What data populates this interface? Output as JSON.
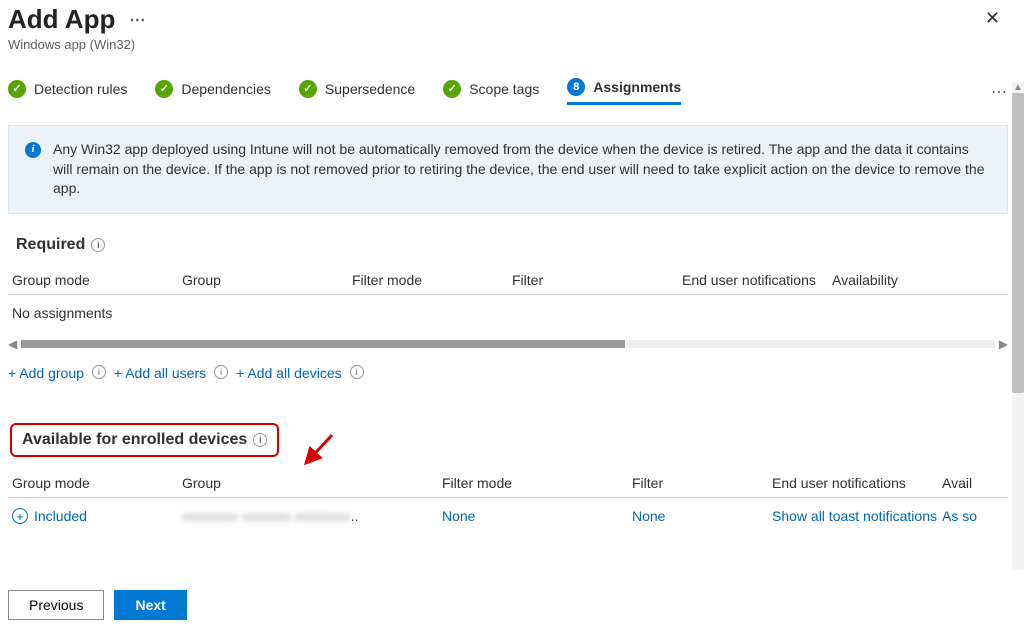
{
  "header": {
    "title": "Add App",
    "subtitle": "Windows app (Win32)"
  },
  "tabs": {
    "detection": "Detection rules",
    "dependencies": "Dependencies",
    "supersedence": "Supersedence",
    "scope": "Scope tags",
    "assignments_num": "8",
    "assignments": "Assignments"
  },
  "banner": "Any Win32 app deployed using Intune will not be automatically removed from the device when the device is retired. The app and the data it contains will remain on the device. If the app is not removed prior to retiring the device, the end user will need to take explicit action on the device to remove the app.",
  "required": {
    "title": "Required",
    "cols": {
      "mode": "Group mode",
      "group": "Group",
      "fmode": "Filter mode",
      "filter": "Filter",
      "notif": "End user notifications",
      "avail": "Availability"
    },
    "empty": "No assignments"
  },
  "links": {
    "add_group": "+ Add group",
    "add_users": "+ Add all users",
    "add_devices": "+ Add all devices"
  },
  "available": {
    "title": "Available for enrolled devices",
    "cols": {
      "mode": "Group mode",
      "group": "Group",
      "fmode": "Filter mode",
      "filter": "Filter",
      "notif": "End user notifications",
      "avail": "Avail"
    },
    "row": {
      "included": "Included",
      "group_blur": "xxxxxxxx xxxxxxx xxxxxxxx",
      "fmode": "None",
      "filter": "None",
      "notif": "Show all toast notifications",
      "avail": "As so"
    }
  },
  "footer": {
    "prev": "Previous",
    "next": "Next"
  }
}
